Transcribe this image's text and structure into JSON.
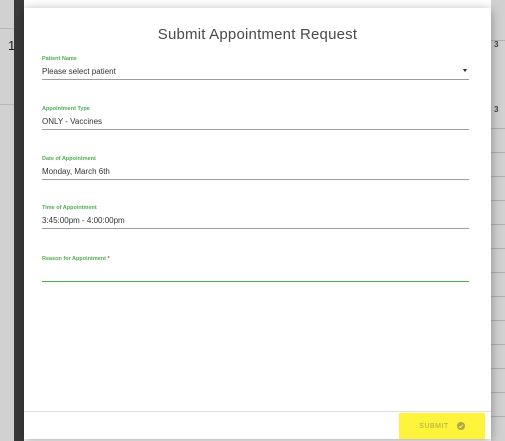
{
  "modal": {
    "title": "Submit Appointment Request"
  },
  "fields": {
    "patient": {
      "label": "Patient Name",
      "value": "Please select patient"
    },
    "appointment_type": {
      "label": "Appointment Type",
      "value": "ONLY - Vaccines"
    },
    "date": {
      "label": "Date of Appointment",
      "value": "Monday, March 6th"
    },
    "time": {
      "label": "Time of Appointment",
      "value": "3:45:00pm - 4:00:00pm"
    },
    "reason": {
      "label": "Reason for Appointment",
      "required_marker": "*",
      "value": ""
    }
  },
  "footer": {
    "submit_label": "SUBMIT"
  },
  "colors": {
    "accent_green": "#4caf50",
    "highlight_yellow": "#fff33b",
    "required_red": "#e53935"
  },
  "background": {
    "fragments": [
      "1",
      "3",
      "3"
    ]
  }
}
